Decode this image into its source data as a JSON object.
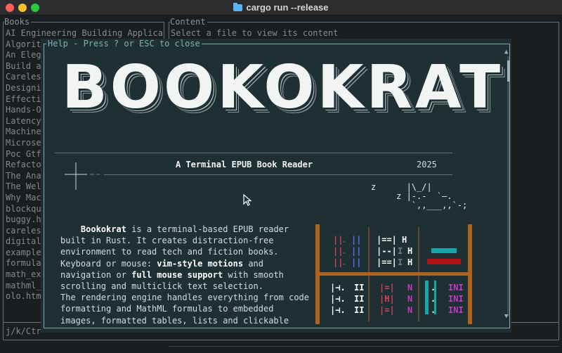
{
  "window": {
    "title": "cargo run --release"
  },
  "books_pane": {
    "title": "Books",
    "items": [
      "AI Engineering Building Applica",
      "Algorit",
      "An Eleg",
      "Build a",
      "Careles",
      "Designi",
      "Effecti",
      "Hands-O",
      "Latency",
      "Machine",
      "Microse",
      "Poc Gtf",
      "Refacto",
      "The Ana",
      "The Wel",
      "Why Mac",
      "blockqu",
      "buggy.h",
      "careles",
      "digital",
      "example",
      "formula",
      "math_ex",
      "mathml_",
      "olo.htm"
    ]
  },
  "content_pane": {
    "title": "Content",
    "placeholder": "Select a file to view its content"
  },
  "status_bar": {
    "text": "j/k/Ctr"
  },
  "help": {
    "title": "Help - Press ? or ESC to close",
    "logo": "BOOKOKRAT",
    "subtitle": "A Terminal EPUB Book Reader",
    "year": "2025",
    "cat_art": "z      |\\_/|\n     z |-.-  `—.\n        `,,___,,`-;",
    "cat_z": "z",
    "desc": {
      "name": "Bookokrat",
      "p1": " is a terminal-based EPUB reader built in Rust. It creates distraction-free environment to read tech and fiction books. Keyboard or mouse: ",
      "vim": "vim-style motions",
      "p2": " and navigation or ",
      "mouse": "full mouse support",
      "p3": " with smooth scrolling and multiclick text selection.",
      "p4": "The rendering engine handles everything from code formatting and MathML formulas to embedded images, formatted tables, lists and clickable"
    },
    "shelf_top_left": [
      "||  ||",
      "||  ||",
      "||  ||"
    ],
    "shelf_top_mid": [
      "|==|  H",
      "|--| I H",
      "|==| I H"
    ],
    "shelf_bottom_left": [
      "|⊣. II",
      "|⊣. II",
      "|⊣. II"
    ],
    "shelf_bottom_mid": [
      "|=|  N",
      "|H|  N",
      "|=|  N"
    ],
    "shelf_bottom_right": [
      "INI",
      "INI",
      "INI"
    ],
    "colors": {
      "shelf_wood": "#b0611b",
      "red_book": "#d9425a",
      "blue_book": "#5674e6",
      "teal_book": "#17a7a8",
      "magenta_book": "#c13ac1",
      "dark_red_book": "#b01414"
    }
  }
}
